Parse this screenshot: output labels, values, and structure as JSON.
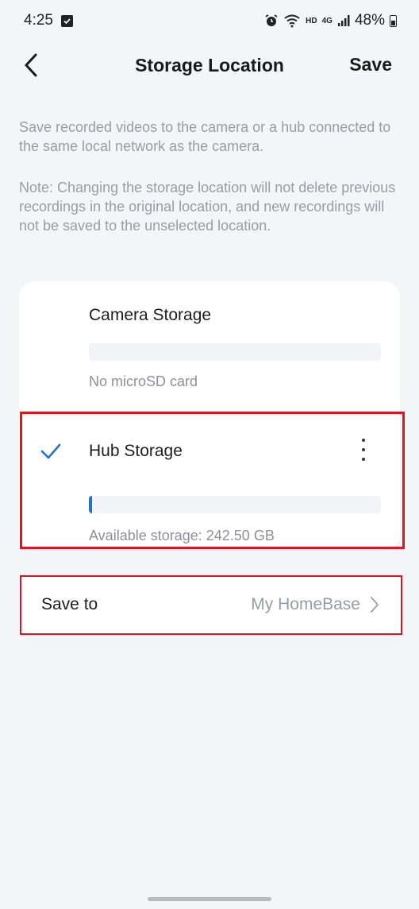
{
  "status_bar": {
    "time": "4:25",
    "network_hd": "HD",
    "network_4g": "4G",
    "battery": "48%"
  },
  "header": {
    "title": "Storage Location",
    "save_label": "Save"
  },
  "description": {
    "main": "Save recorded videos to the camera or a hub connected to the same local network as the camera.",
    "note": "Note: Changing the storage location will not delete previous recordings in the original location, and new recordings will not be saved to the unselected location."
  },
  "storage_options": [
    {
      "title": "Camera Storage",
      "subtitle": "No microSD card",
      "selected": false,
      "usage_fraction": 0
    },
    {
      "title": "Hub Storage",
      "subtitle": "Available storage: 242.50 GB",
      "selected": true,
      "usage_fraction": 0.01
    }
  ],
  "save_to": {
    "label": "Save to",
    "value": "My HomeBase"
  },
  "colors": {
    "accent": "#1f73c9",
    "highlight": "#e0141f",
    "background": "#f4f5f9"
  }
}
